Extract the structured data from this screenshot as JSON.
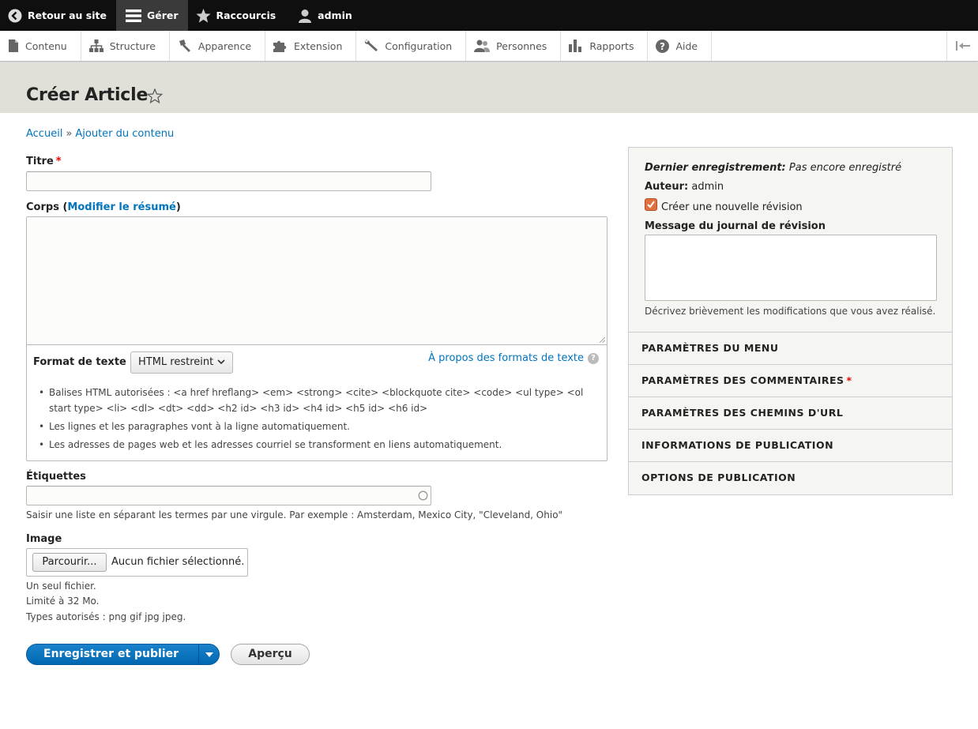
{
  "toolbar": {
    "back_label": "Retour au site",
    "manage_label": "Gérer",
    "shortcuts_label": "Raccourcis",
    "user_label": "admin"
  },
  "tray": {
    "items": [
      {
        "label": "Contenu",
        "icon": "page-icon"
      },
      {
        "label": "Structure",
        "icon": "sitemap-icon"
      },
      {
        "label": "Apparence",
        "icon": "paintbrush-icon"
      },
      {
        "label": "Extension",
        "icon": "puzzle-icon"
      },
      {
        "label": "Configuration",
        "icon": "wrench-icon"
      },
      {
        "label": "Personnes",
        "icon": "people-icon"
      },
      {
        "label": "Rapports",
        "icon": "bar-chart-icon"
      },
      {
        "label": "Aide",
        "icon": "question-icon"
      }
    ]
  },
  "page": {
    "title": "Créer Article"
  },
  "breadcrumb": {
    "home": "Accueil",
    "separator": "»",
    "current": "Ajouter du contenu"
  },
  "form": {
    "title_label": "Titre",
    "required_mark": "*",
    "body_label_prefix": "Corps (",
    "body_summary_link": "Modifier le résumé",
    "body_label_suffix": ")",
    "format_label": "Format de texte",
    "format_selected": "HTML restreint",
    "format_about": "À propos des formats de texte",
    "format_tips": [
      "Balises HTML autorisées : <a href hreflang> <em> <strong> <cite> <blockquote cite> <code> <ul type> <ol start type> <li> <dl> <dt> <dd> <h2 id> <h3 id> <h4 id> <h5 id> <h6 id>",
      "Les lignes et les paragraphes vont à la ligne automatiquement.",
      "Les adresses de pages web et les adresses courriel se transforment en liens automatiquement."
    ],
    "tags_label": "Étiquettes",
    "tags_desc": "Saisir une liste en séparant les termes par une virgule. Par exemple : Amsterdam, Mexico City, \"Cleveland, Ohio\"",
    "image_label": "Image",
    "browse_button": "Parcourir...",
    "no_file": "Aucun fichier sélectionné.",
    "image_desc": [
      "Un seul fichier.",
      "Limité à 32 Mo.",
      "Types autorisés : png gif jpg jpeg."
    ],
    "save_button": "Enregistrer et publier",
    "preview_button": "Aperçu"
  },
  "sidebar": {
    "last_saved_label": "Dernier enregistrement:",
    "last_saved_value": "Pas encore enregistré",
    "author_label": "Auteur:",
    "author_value": "admin",
    "new_revision_label": "Créer une nouvelle révision",
    "new_revision_checked": true,
    "log_label": "Message du journal de révision",
    "log_desc": "Décrivez brièvement les modifications que vous avez réalisé.",
    "sections": [
      {
        "label": "PARAMÈTRES DU MENU",
        "required": false
      },
      {
        "label": "PARAMÈTRES DES COMMENTAIRES",
        "required": true
      },
      {
        "label": "PARAMÈTRES DES CHEMINS D'URL",
        "required": false
      },
      {
        "label": "INFORMATIONS DE PUBLICATION",
        "required": false
      },
      {
        "label": "OPTIONS DE PUBLICATION",
        "required": false
      }
    ]
  },
  "colors": {
    "link": "#0074bd",
    "primary_button": "#0071b8",
    "toolbar_bg": "#0f0f0f",
    "header_bg": "#e0e0d8",
    "required": "#ee0000",
    "checkbox": "#e07040"
  }
}
